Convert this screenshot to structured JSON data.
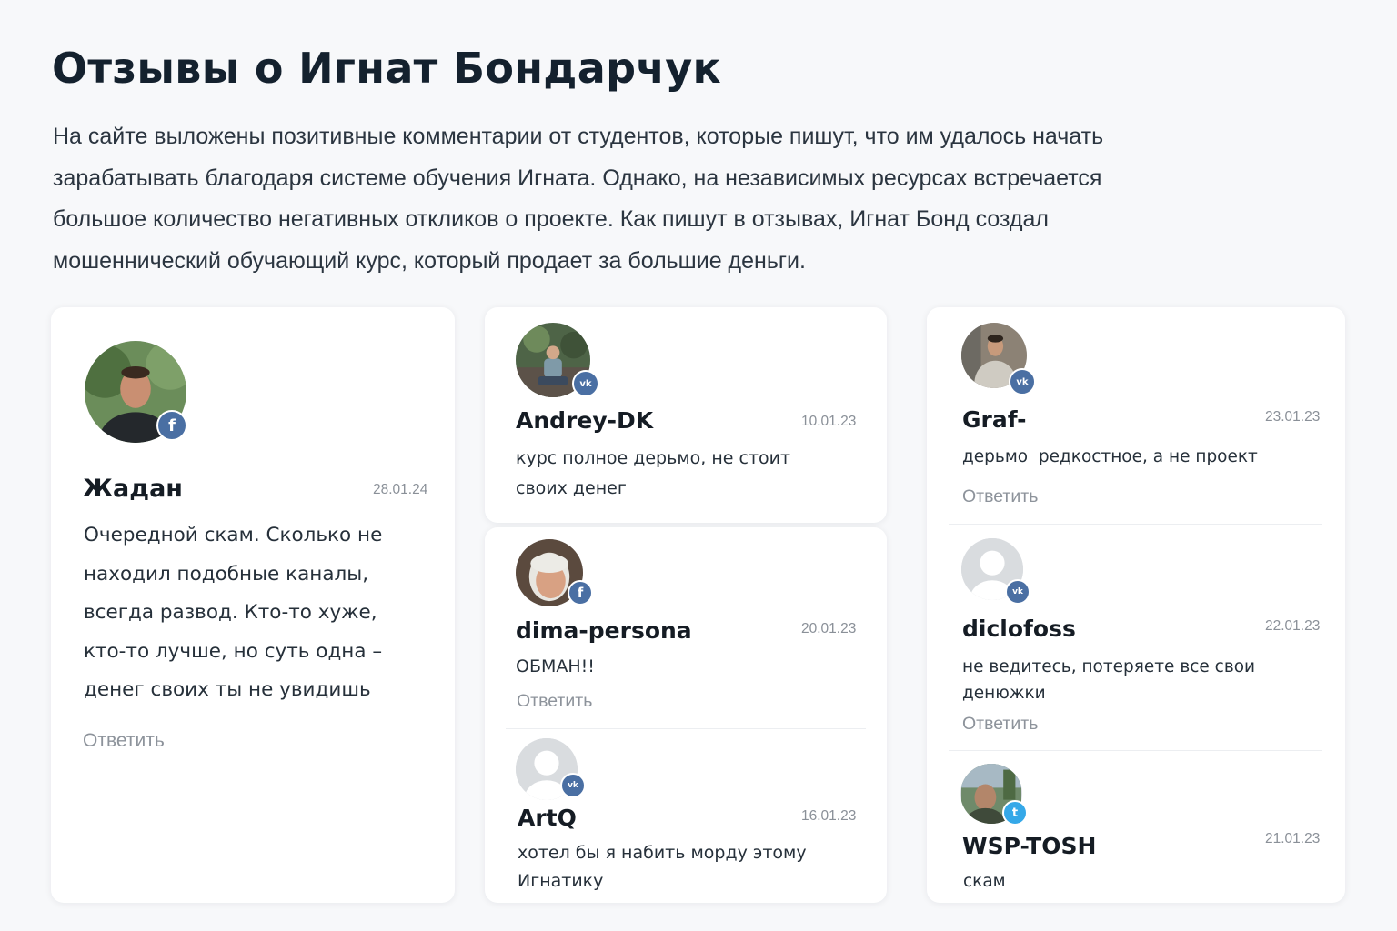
{
  "page": {
    "title": "Отзывы о Игнат Бондарчук",
    "intro": "На сайте выложены позитивные комментарии от студентов, которые пишут, что им удалось начать зарабатывать благодаря системе обучения Игната. Однако, на независимых ресурсах встречается большое количество негативных откликов о проекте. Как пишут в отзывах, Игнат Бонд создал мошеннический обучающий курс, который продает за большие деньги."
  },
  "reviews": [
    {
      "name": "Жадан",
      "date": "28.01.24",
      "text": "Очередной скам. Сколько не находил подобные каналы, всегда развод. Кто-то хуже, кто-то лучше, но суть одна – денег своих ты не увидишь",
      "reply": "Ответить",
      "network": "facebook-icon",
      "badge": "f"
    },
    {
      "name": "Andrey-DK",
      "date": "10.01.23",
      "text": "курс полное дерьмо, не стоит своих денег",
      "network": "vk-icon",
      "badge": "vk"
    },
    {
      "name": "dima-persona",
      "date": "20.01.23",
      "text": "ОБМАН!!",
      "reply": "Ответить",
      "network": "facebook-icon",
      "badge": "f"
    },
    {
      "name": "ArtQ",
      "date": "16.01.23",
      "text": "хотел бы я набить морду этому Игнатику",
      "network": "vk-icon",
      "badge": "vk"
    },
    {
      "name": "Graf-",
      "date": "23.01.23",
      "text": "дерьмо  редкостное, а не проект",
      "reply": "Ответить",
      "network": "vk-icon",
      "badge": "vk"
    },
    {
      "name": "diclofoss",
      "date": "22.01.23",
      "text": "не ведитесь, потеряете все свои денюжки",
      "reply": "Ответить",
      "network": "vk-icon",
      "badge": "vk"
    },
    {
      "name": "WSP-TOSH",
      "date": "21.01.23",
      "text": "скам",
      "network": "twitter-icon",
      "badge": "t"
    }
  ],
  "colors": {
    "background": "#f7f8fa",
    "card": "#ffffff",
    "vk_badge": "#4a6fa3",
    "facebook_badge": "#4a6fa3",
    "twitter_badge": "#35a8e8",
    "muted_text": "#8d939b"
  }
}
